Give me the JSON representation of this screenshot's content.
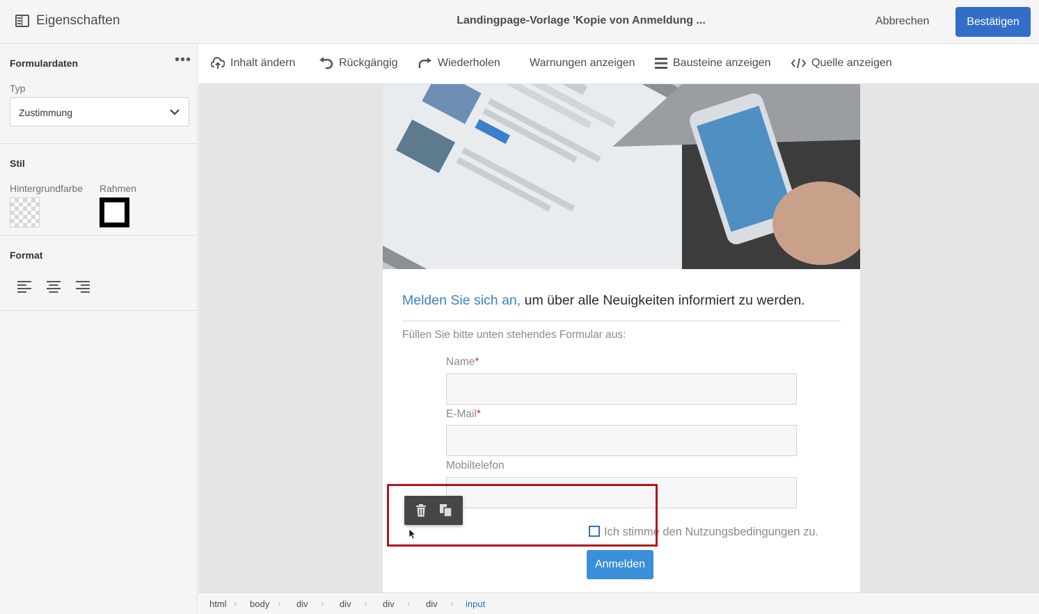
{
  "header": {
    "properties_label": "Eigenschaften",
    "title": "Landingpage-Vorlage 'Kopie von Anmeldung ...",
    "cancel_label": "Abbrechen",
    "confirm_label": "Bestätigen"
  },
  "sidebar": {
    "form_section": {
      "title": "Formulardaten",
      "type_label": "Typ",
      "type_value": "Zustimmung"
    },
    "style_section": {
      "title": "Stil",
      "background_label": "Hintergrundfarbe",
      "border_label": "Rahmen"
    },
    "format_section": {
      "title": "Format"
    }
  },
  "toolbar": {
    "change_content": "Inhalt ändern",
    "undo": "Rückgängig",
    "redo": "Wiederholen",
    "warnings": "Warnungen anzeigen",
    "blocks": "Bausteine anzeigen",
    "source": "Quelle anzeigen"
  },
  "form": {
    "headline_accent": "Melden Sie sich an,",
    "headline_rest": " um über alle Neuigkeiten informiert zu werden.",
    "intro": "Füllen Sie bitte unten stehendes Formular aus:",
    "name_label": "Name",
    "email_label": "E-Mail",
    "mobile_label": "Mobiltelefon",
    "required_mark": "*",
    "consent_text": "Ich stimme den Nutzungsbedingungen zu.",
    "submit_label": "Anmelden"
  },
  "breadcrumb": [
    "html",
    "body",
    "div",
    "div",
    "div",
    "div",
    "input"
  ],
  "colors": {
    "accent": "#326ec8",
    "selection": "#b0161c",
    "link": "#3a80c9"
  }
}
